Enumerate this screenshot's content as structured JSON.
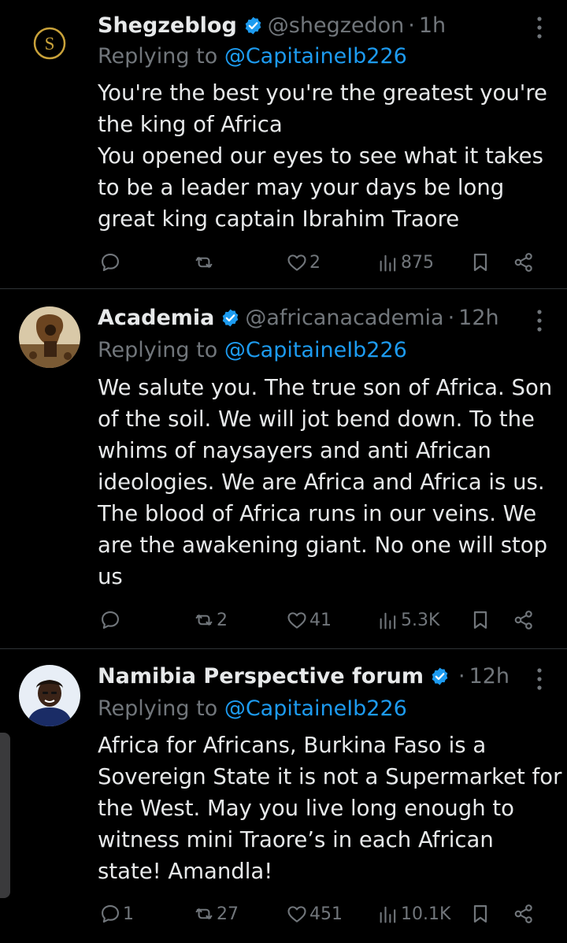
{
  "posts": [
    {
      "name": "Shegzeblog",
      "handle": "@shegzedon",
      "time": "1h",
      "replying_prefix": "Replying to",
      "replying_to": "@CapitaineIb226",
      "text": "You're the best you're the greatest you're the king of Africa\nYou opened our eyes to see what it takes to be a leader may your days be long great king captain Ibrahim  Traore",
      "replies": "",
      "reposts": "",
      "likes": "2",
      "views": "875",
      "avatar": {
        "letter": "S"
      }
    },
    {
      "name": "Academia",
      "handle": "@africanacademia",
      "time": "12h",
      "replying_prefix": "Replying to",
      "replying_to": "@CapitaineIb226",
      "text": "We salute you. The true son of Africa. Son of the soil. We will jot bend down. To the whims of naysayers and anti African ideologies. We are Africa and Africa is us. The blood of Africa runs in our veins. We are the awakening giant. No one will stop us",
      "replies": "",
      "reposts": "2",
      "likes": "41",
      "views": "5.3K"
    },
    {
      "name": "Namibia Perspective forum",
      "handle": "",
      "time": "12h",
      "replying_prefix": "Replying to",
      "replying_to": "@CapitaineIb226",
      "text": "Africa for Africans, Burkina Faso is a Sovereign State it is not a Supermarket for the West. May you live long enough to witness mini Traore’s in each African state! Amandla!",
      "replies": "1",
      "reposts": "27",
      "likes": "451",
      "views": "10.1K"
    }
  ],
  "colors": {
    "background": "#000000",
    "text": "#e7e9ea",
    "muted": "#71767b",
    "link": "#1d9bf0",
    "verified": "#1d9bf0",
    "avatar_gold": "#c9a23a"
  },
  "icons": [
    "verified-icon",
    "more-icon",
    "reply-icon",
    "repost-icon",
    "like-icon",
    "views-icon",
    "bookmark-icon",
    "share-icon"
  ]
}
